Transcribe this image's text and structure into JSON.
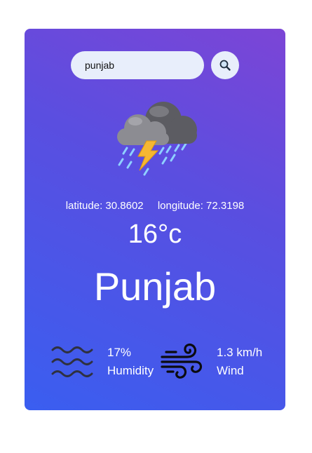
{
  "search": {
    "value": "punjab",
    "button_icon": "search-icon"
  },
  "weather": {
    "icon": "thunderstorm-icon",
    "latitude_text": "latitude: 30.8602",
    "longitude_text": "longitude: 72.3198",
    "temperature": "16°c",
    "city": "Punjab"
  },
  "humidity": {
    "icon": "waves-icon",
    "value": "17%",
    "label": "Humidity"
  },
  "wind": {
    "icon": "wind-icon",
    "value": "1.3 km/h",
    "label": "Wind"
  },
  "colors": {
    "card_top": "#7c45d6",
    "card_bottom": "#3a5ef0",
    "input_bg": "#e8eefb",
    "text": "#ffffff"
  }
}
